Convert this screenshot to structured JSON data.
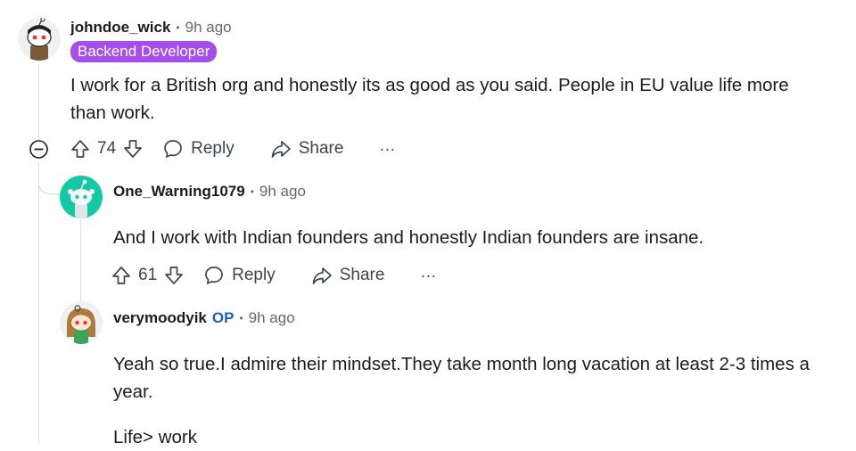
{
  "comments": [
    {
      "username": "johndoe_wick",
      "time": "9h ago",
      "flair": "Backend Developer",
      "body": [
        "I work for a British org and honestly its as good as you said. People in EU value life more",
        "than work."
      ],
      "score": "74",
      "reply_label": "Reply",
      "share_label": "Share",
      "more_label": "···"
    },
    {
      "username": "One_Warning1079",
      "time": "9h ago",
      "body": [
        "And I work with Indian founders and honestly Indian founders are insane."
      ],
      "score": "61",
      "reply_label": "Reply",
      "share_label": "Share",
      "more_label": "···"
    },
    {
      "username": "verymoodyik",
      "op_badge": "OP",
      "time": "9h ago",
      "body": [
        "Yeah so true.I admire their mindset.They take month long vacation at least 2-3 times a",
        "year."
      ],
      "body2": "Life> work"
    }
  ],
  "separator": "•",
  "colors": {
    "flair_bg": "#a64ee9",
    "op": "#1d5ec9",
    "thread_line": "#d9dee1"
  },
  "icons": [
    "collapse-icon",
    "upvote-icon",
    "downvote-icon",
    "reply-icon",
    "share-icon",
    "more-icon"
  ]
}
